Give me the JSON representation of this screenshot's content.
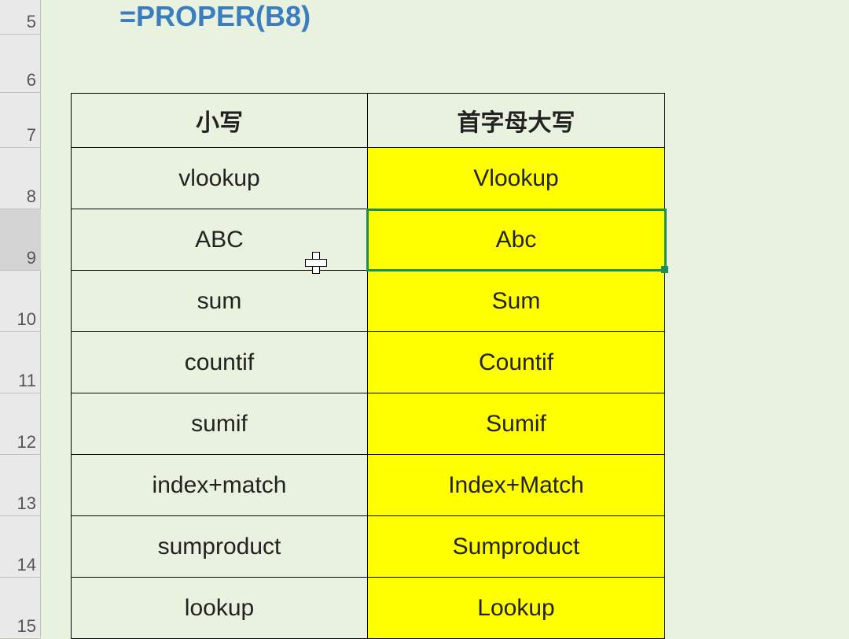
{
  "formula": "=PROPER(B8)",
  "row_headers": [
    "5",
    "6",
    "7",
    "8",
    "9",
    "10",
    "11",
    "12",
    "13",
    "14",
    "15"
  ],
  "selected_row": "9",
  "table": {
    "headers": {
      "left": "小写",
      "right": "首字母大写"
    },
    "rows": [
      {
        "left": "vlookup",
        "right": "Vlookup"
      },
      {
        "left": "ABC",
        "right": "Abc"
      },
      {
        "left": "sum",
        "right": "Sum"
      },
      {
        "left": "countif",
        "right": "Countif"
      },
      {
        "left": "sumif",
        "right": "Sumif"
      },
      {
        "left": "index+match",
        "right": "Index+Match"
      },
      {
        "left": "sumproduct",
        "right": "Sumproduct"
      },
      {
        "left": "lookup",
        "right": "Lookup"
      }
    ]
  }
}
